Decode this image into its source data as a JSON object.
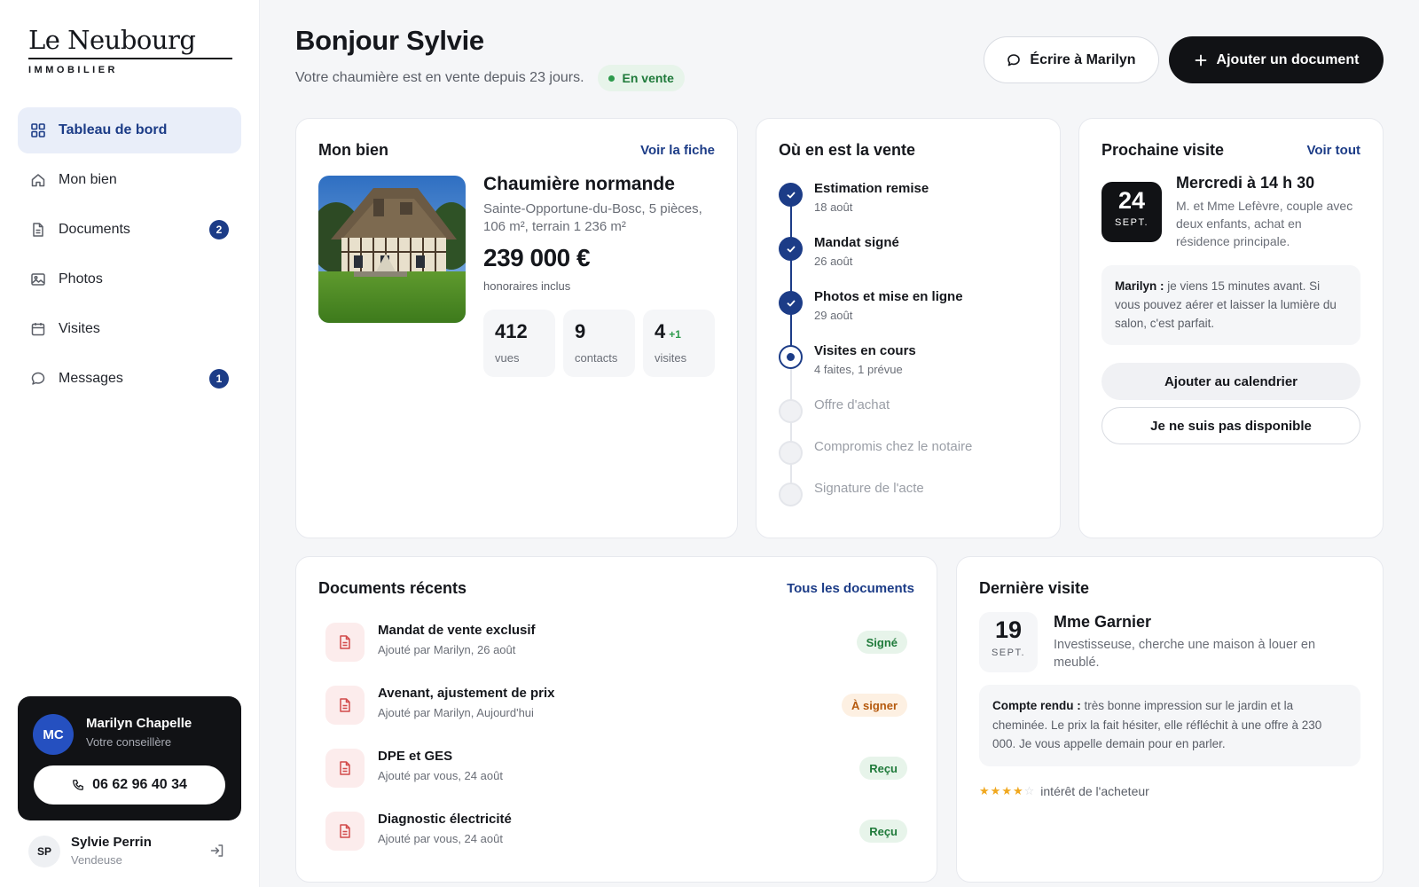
{
  "brand": {
    "name": "Le Neubourg",
    "sub": "IMMOBILIER"
  },
  "nav": [
    {
      "label": "Tableau de bord",
      "icon": "dashboard-icon",
      "badge": ""
    },
    {
      "label": "Mon bien",
      "icon": "home-icon",
      "badge": ""
    },
    {
      "label": "Documents",
      "icon": "document-icon",
      "badge": "2"
    },
    {
      "label": "Photos",
      "icon": "image-icon",
      "badge": ""
    },
    {
      "label": "Visites",
      "icon": "calendar-icon",
      "badge": ""
    },
    {
      "label": "Messages",
      "icon": "chat-icon",
      "badge": "1"
    }
  ],
  "advisor": {
    "initials": "MC",
    "name": "Marilyn Chapelle",
    "role": "Votre conseillère",
    "phone": "06 62 96 40 34"
  },
  "user": {
    "initials": "SP",
    "name": "Sylvie Perrin",
    "role": "Vendeuse"
  },
  "header": {
    "greeting": "Bonjour Sylvie",
    "subline": "Votre chaumière est en vente depuis 23 jours.",
    "status": "En vente",
    "write_button": "Écrire à Marilyn",
    "add_button": "Ajouter un document"
  },
  "property": {
    "card_title": "Mon bien",
    "link": "Voir la fiche",
    "name": "Chaumière normande",
    "location": "Sainte-Opportune-du-Bosc, 5 pièces, 106 m², terrain 1 236 m²",
    "price": "239 000 €",
    "fees": "honoraires inclus",
    "stats": [
      {
        "value": "412",
        "extra": "",
        "label": "vues"
      },
      {
        "value": "9",
        "extra": "",
        "label": "contacts"
      },
      {
        "value": "4",
        "extra": "+1",
        "label": "visites"
      }
    ]
  },
  "progress": {
    "card_title": "Où en est la vente",
    "steps": [
      {
        "label": "Estimation remise",
        "sub": "18 août",
        "state": "done"
      },
      {
        "label": "Mandat signé",
        "sub": "26 août",
        "state": "done"
      },
      {
        "label": "Photos et mise en ligne",
        "sub": "29 août",
        "state": "done"
      },
      {
        "label": "Visites en cours",
        "sub": "4 faites, 1 prévue",
        "state": "current"
      },
      {
        "label": "Offre d'achat",
        "sub": "",
        "state": "todo"
      },
      {
        "label": "Compromis chez le notaire",
        "sub": "",
        "state": "todo"
      },
      {
        "label": "Signature de l'acte",
        "sub": "",
        "state": "todo"
      }
    ]
  },
  "next_visit": {
    "card_title": "Prochaine visite",
    "link": "Voir tout",
    "day": "24",
    "month": "SEPT.",
    "when": "Mercredi à 14 h 30",
    "desc": "M. et Mme Lefèvre, couple avec deux enfants, achat en résidence principale.",
    "note_author": "Marilyn :",
    "note_text": "je viens 15 minutes avant. Si vous pouvez aérer et laisser la lumière du salon, c'est parfait.",
    "calendar_button": "Ajouter au calendrier",
    "unavailable_button": "Je ne suis pas disponible"
  },
  "documents": {
    "card_title": "Documents récents",
    "link": "Tous les documents",
    "items": [
      {
        "name": "Mandat de vente exclusif",
        "meta": "Ajouté par Marilyn, 26 août",
        "status": "Signé",
        "tone": "ok"
      },
      {
        "name": "Avenant, ajustement de prix",
        "meta": "Ajouté par Marilyn, Aujourd'hui",
        "status": "À signer",
        "tone": "warn"
      },
      {
        "name": "DPE et GES",
        "meta": "Ajouté par vous, 24 août",
        "status": "Reçu",
        "tone": "ok"
      },
      {
        "name": "Diagnostic électricité",
        "meta": "Ajouté par vous, 24 août",
        "status": "Reçu",
        "tone": "ok"
      }
    ]
  },
  "last_visit": {
    "card_title": "Dernière visite",
    "day": "19",
    "month": "SEPT.",
    "name": "Mme Garnier",
    "desc": "Investisseuse, cherche une maison à louer en meublé.",
    "report_label": "Compte rendu :",
    "report_text": "très bonne impression sur le jardin et la cheminée. Le prix la fait hésiter, elle réfléchit à une offre à 230 000. Je vous appelle demain pour en parler.",
    "rating": 4,
    "rating_max": 5,
    "rating_label": "intérêt de l'acheteur"
  },
  "colors": {
    "accent": "#1c3c87",
    "dark": "#111215",
    "success": "#1f7a3a",
    "warning": "#b5590d"
  }
}
